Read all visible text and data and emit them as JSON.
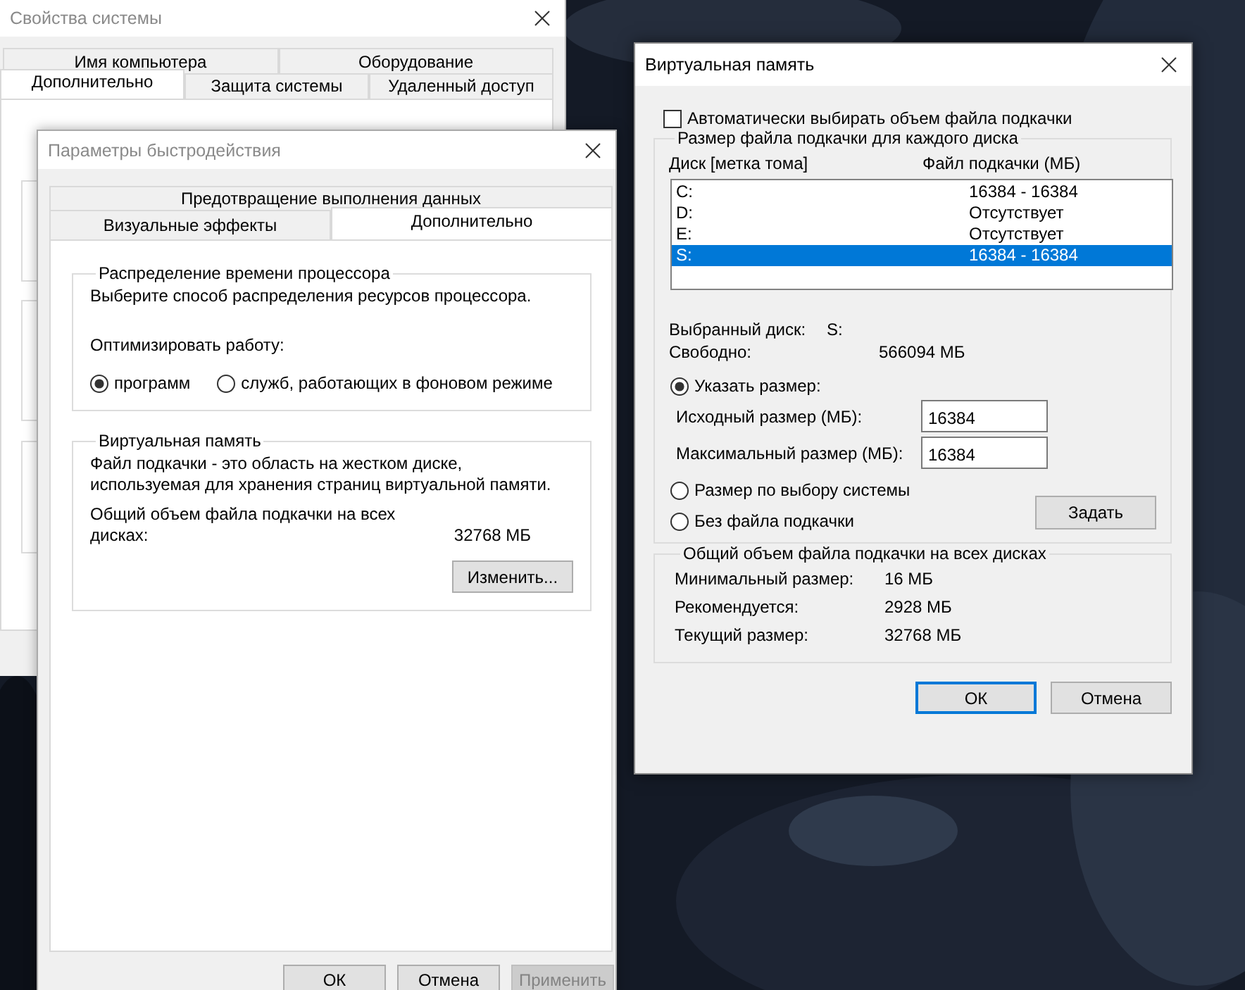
{
  "system_properties_window": {
    "title": "Свойства системы",
    "tab_rows": [
      [
        {
          "label": "Имя компьютера",
          "selected": false
        },
        {
          "label": "Оборудование",
          "selected": false
        }
      ],
      [
        {
          "label": "Дополнительно",
          "selected": true
        },
        {
          "label": "Защита системы",
          "selected": false
        },
        {
          "label": "Удаленный доступ",
          "selected": false
        }
      ]
    ]
  },
  "performance_window": {
    "title": "Параметры быстродействия",
    "tab_rows": [
      [
        {
          "label": "Предотвращение выполнения данных",
          "selected": false
        }
      ],
      [
        {
          "label": "Визуальные эффекты",
          "selected": false
        },
        {
          "label": "Дополнительно",
          "selected": true
        }
      ]
    ],
    "cpu_group": {
      "title": "Распределение времени процессора",
      "description": "Выберите способ распределения ресурсов процессора.",
      "optimize_label": "Оптимизировать работу:",
      "options": [
        {
          "label": "программ",
          "selected": true
        },
        {
          "label": "служб, работающих в фоновом режиме",
          "selected": false
        }
      ]
    },
    "vm_group": {
      "title": "Виртуальная память",
      "description": "Файл подкачки - это область на жестком диске, используемая для хранения страниц виртуальной памяти.",
      "total_label": "Общий объем файла подкачки на всех дисках:",
      "total_value": "32768 МБ",
      "change_button": "Изменить..."
    },
    "buttons": [
      {
        "label": "ОК",
        "disabled": false
      },
      {
        "label": "Отмена",
        "disabled": false
      },
      {
        "label": "Применить",
        "disabled": true
      }
    ]
  },
  "virtual_memory_window": {
    "title": "Виртуальная память",
    "auto_checkbox": {
      "label": "Автоматически выбирать объем файла подкачки",
      "checked": false
    },
    "drive_group": {
      "title": "Размер файла подкачки для каждого диска",
      "columns": [
        "Диск [метка тома]",
        "Файл подкачки (МБ)"
      ],
      "drives": [
        {
          "drive": "C:",
          "size": "16384 - 16384",
          "selected": false
        },
        {
          "drive": "D:",
          "size": "Отсутствует",
          "selected": false
        },
        {
          "drive": "E:",
          "size": "Отсутствует",
          "selected": false
        },
        {
          "drive": "S:",
          "size": "16384 - 16384",
          "selected": true
        }
      ],
      "selected_drive_label": "Выбранный диск:",
      "selected_drive_value": "S:",
      "free_label": "Свободно:",
      "free_value": "566094 МБ",
      "size_options": [
        {
          "kind": "custom",
          "label": "Указать размер:",
          "selected": true
        },
        {
          "kind": "plain",
          "label": "Размер по выбору системы",
          "selected": false
        },
        {
          "kind": "plain",
          "label": "Без файла подкачки",
          "selected": false
        }
      ],
      "initial_label": "Исходный размер (МБ):",
      "initial_value": "16384",
      "max_label": "Максимальный размер (МБ):",
      "max_value": "16384",
      "set_button": "Задать"
    },
    "totals_group": {
      "title": "Общий объем файла подкачки на всех дисках",
      "rows": [
        {
          "label": "Минимальный размер:",
          "value": "16 МБ"
        },
        {
          "label": "Рекомендуется:",
          "value": "2928 МБ"
        },
        {
          "label": "Текущий размер:",
          "value": "32768 МБ"
        }
      ]
    },
    "buttons": [
      {
        "label": "ОК",
        "default": true
      },
      {
        "label": "Отмена",
        "default": false
      }
    ]
  }
}
